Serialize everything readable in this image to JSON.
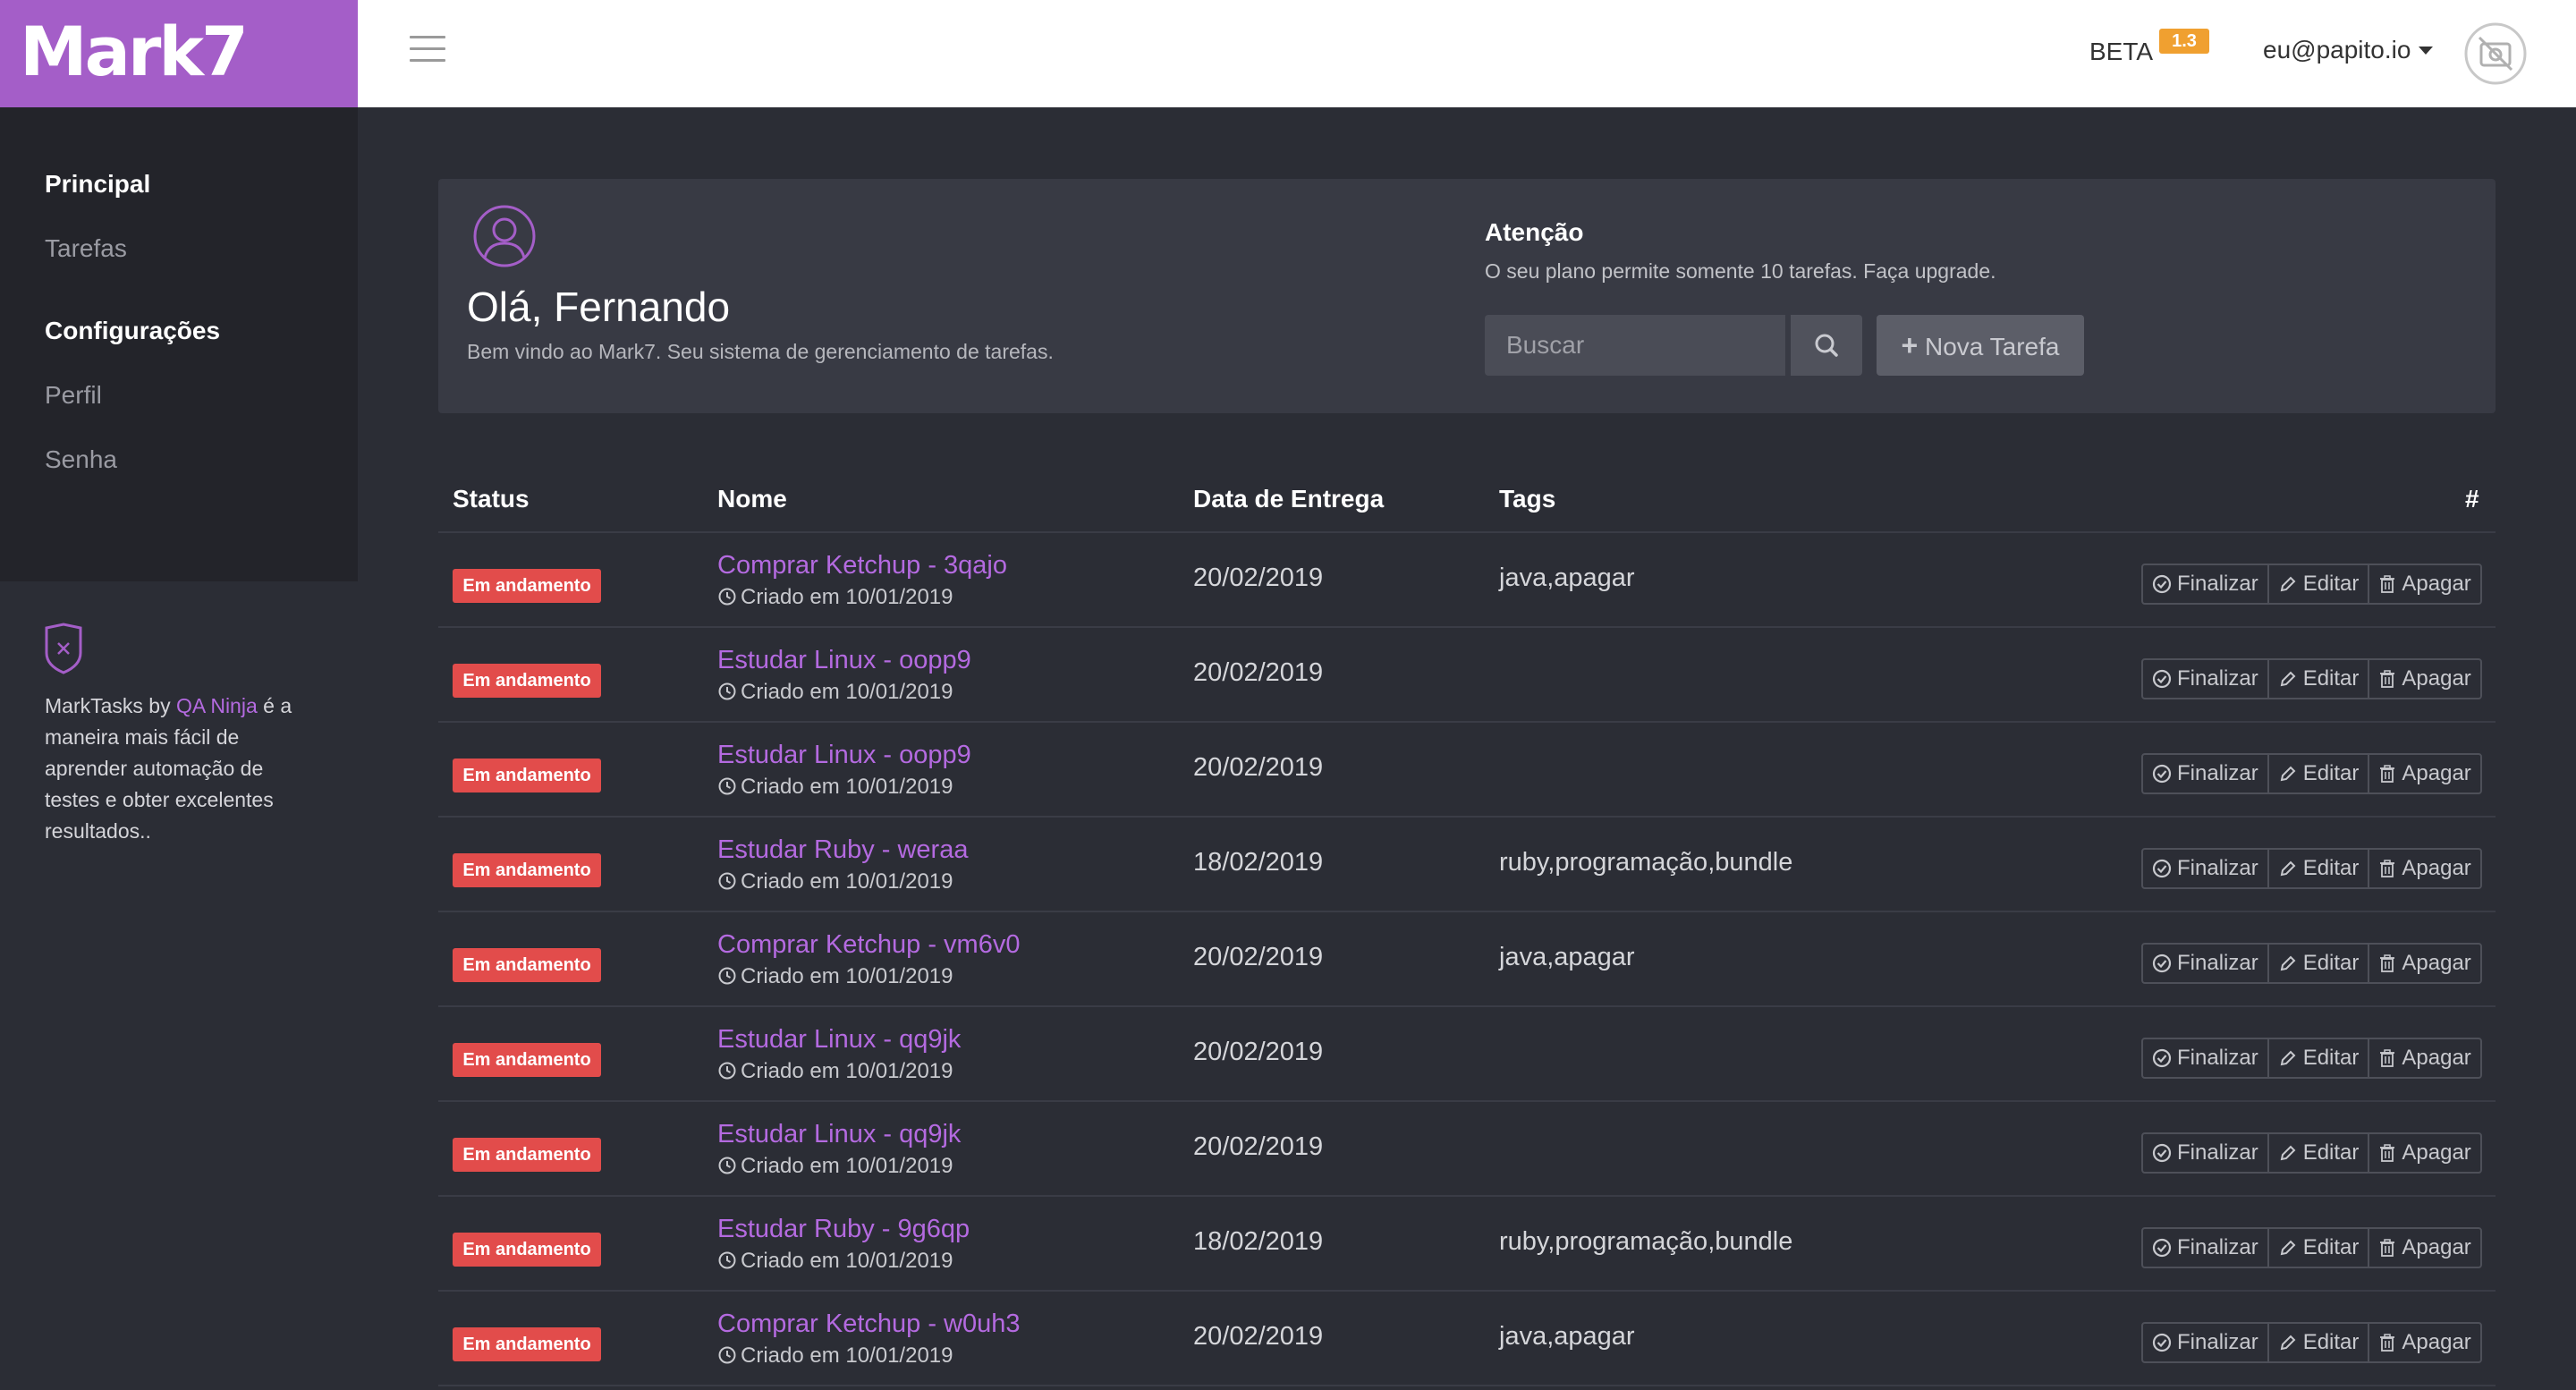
{
  "header": {
    "logo": "Mark7",
    "beta_label": "BETA",
    "version": "1.3",
    "user_email": "eu@papito.io"
  },
  "sidebar": {
    "section1": "Principal",
    "item_tasks": "Tarefas",
    "section2": "Configurações",
    "item_profile": "Perfil",
    "item_password": "Senha",
    "info_prefix": "MarkTasks by",
    "info_link": "QA Ninja",
    "info_suffix": "é a maneira mais fácil de aprender automação de testes e obter excelentes resultados.."
  },
  "hero": {
    "greeting": "Olá, Fernando",
    "subtitle": "Bem vindo ao Mark7. Seu sistema de gerenciamento de tarefas.",
    "attention_title": "Atenção",
    "attention_text": "O seu plano permite somente 10 tarefas. Faça upgrade.",
    "search_placeholder": "Buscar",
    "new_task_label": "Nova Tarefa"
  },
  "table": {
    "columns": [
      "Status",
      "Nome",
      "Data de Entrega",
      "Tags",
      "#"
    ],
    "actions": {
      "finish": "Finalizar",
      "edit": "Editar",
      "delete": "Apagar"
    },
    "rows": [
      {
        "status": "Em andamento",
        "name": "Comprar Ketchup - 3qajo",
        "created": "Criado em 10/01/2019",
        "due": "20/02/2019",
        "tags": "java,apagar"
      },
      {
        "status": "Em andamento",
        "name": "Estudar Linux - oopp9",
        "created": "Criado em 10/01/2019",
        "due": "20/02/2019",
        "tags": ""
      },
      {
        "status": "Em andamento",
        "name": "Estudar Linux - oopp9",
        "created": "Criado em 10/01/2019",
        "due": "20/02/2019",
        "tags": ""
      },
      {
        "status": "Em andamento",
        "name": "Estudar Ruby - weraa",
        "created": "Criado em 10/01/2019",
        "due": "18/02/2019",
        "tags": "ruby,programação,bundle"
      },
      {
        "status": "Em andamento",
        "name": "Comprar Ketchup - vm6v0",
        "created": "Criado em 10/01/2019",
        "due": "20/02/2019",
        "tags": "java,apagar"
      },
      {
        "status": "Em andamento",
        "name": "Estudar Linux - qq9jk",
        "created": "Criado em 10/01/2019",
        "due": "20/02/2019",
        "tags": ""
      },
      {
        "status": "Em andamento",
        "name": "Estudar Linux - qq9jk",
        "created": "Criado em 10/01/2019",
        "due": "20/02/2019",
        "tags": ""
      },
      {
        "status": "Em andamento",
        "name": "Estudar Ruby - 9g6qp",
        "created": "Criado em 10/01/2019",
        "due": "18/02/2019",
        "tags": "ruby,programação,bundle"
      },
      {
        "status": "Em andamento",
        "name": "Comprar Ketchup - w0uh3",
        "created": "Criado em 10/01/2019",
        "due": "20/02/2019",
        "tags": "java,apagar"
      }
    ]
  },
  "colors": {
    "brand": "#a45ec8",
    "link": "#b46ae0",
    "status_badge": "#e24c4b",
    "beta_badge": "#f0a030"
  }
}
